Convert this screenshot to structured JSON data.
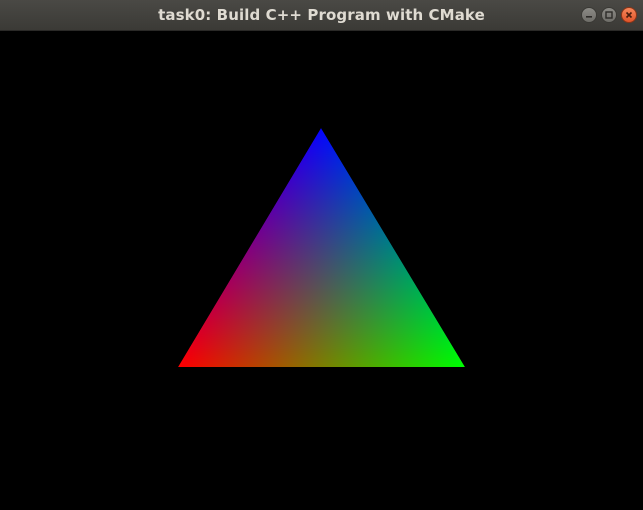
{
  "window": {
    "title": "task0: Build C++ Program with CMake",
    "controls": [
      {
        "name": "minimize-icon",
        "icon": "minimize"
      },
      {
        "name": "maximize-icon",
        "icon": "maximize"
      },
      {
        "name": "close-icon",
        "icon": "close"
      }
    ]
  },
  "scene": {
    "background_color": "#000000",
    "triangle": {
      "vertex_colors": {
        "top": "#0000ff",
        "bottom_left": "#ff0000",
        "bottom_right": "#00ff00"
      }
    }
  }
}
